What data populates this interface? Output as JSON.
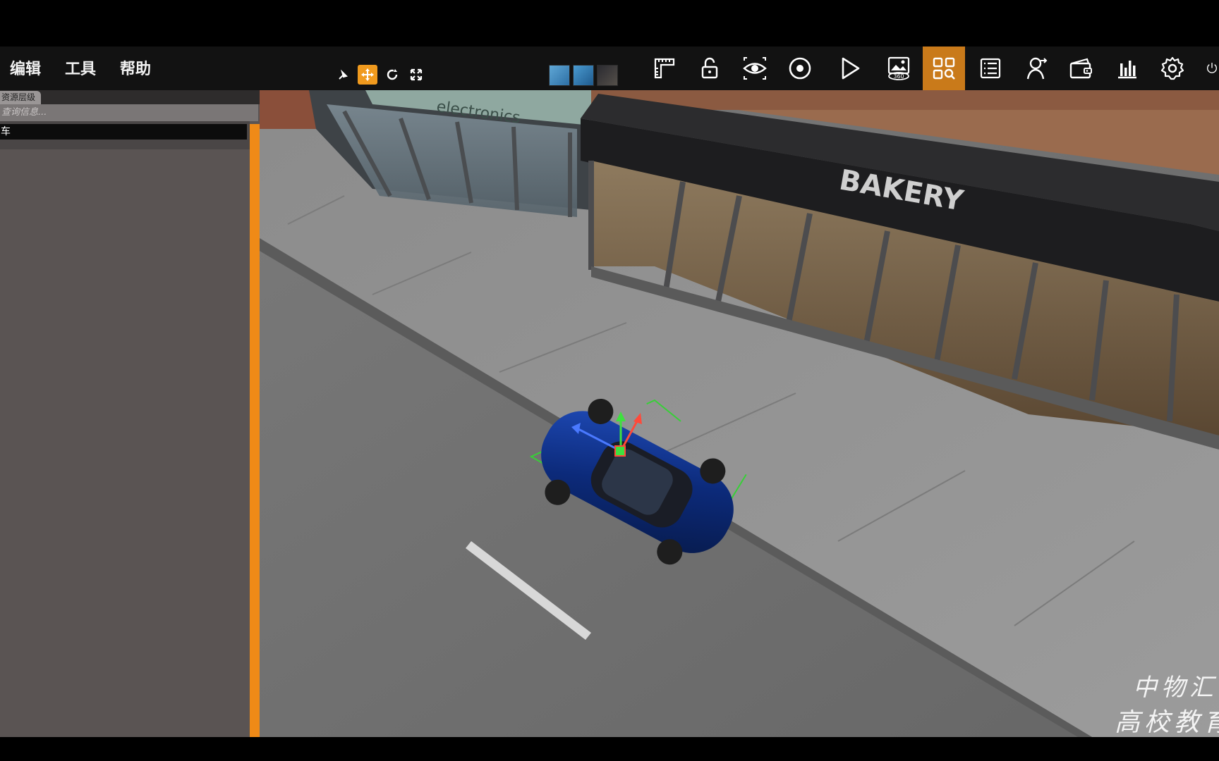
{
  "menu": {
    "edit": "编辑",
    "tools": "工具",
    "help": "帮助"
  },
  "gizmo_tools": [
    {
      "icon": "select-icon",
      "active": false
    },
    {
      "icon": "move-icon",
      "active": true
    },
    {
      "icon": "rotate-icon",
      "active": false
    },
    {
      "icon": "scale-icon",
      "active": false
    }
  ],
  "toolbar_icons": [
    "ruler-icon",
    "lock-icon",
    "eye-icon",
    "record-icon",
    "play-icon",
    "panorama-360-icon",
    "grid-search-icon",
    "list-icon",
    "user-move-icon",
    "wallet-icon",
    "bar-chart-icon",
    "gear-icon",
    "power-icon"
  ],
  "toolbar_active": "grid-search-icon",
  "panorama_label": "360",
  "left_panel": {
    "tab_label": "资源层级",
    "search_placeholder": "查询信息...",
    "tree_item": "车"
  },
  "scene": {
    "store_sign_1": "electronics",
    "store_sign_2": "BAKERY"
  },
  "watermark": {
    "line1": "中物汇",
    "line2": "高校教育"
  },
  "colors": {
    "accent": "#ef8a17",
    "toolbar_bg": "#121212",
    "panel_bg": "#5a5453",
    "car": "#0c2a7a",
    "selection": "#37d037"
  }
}
